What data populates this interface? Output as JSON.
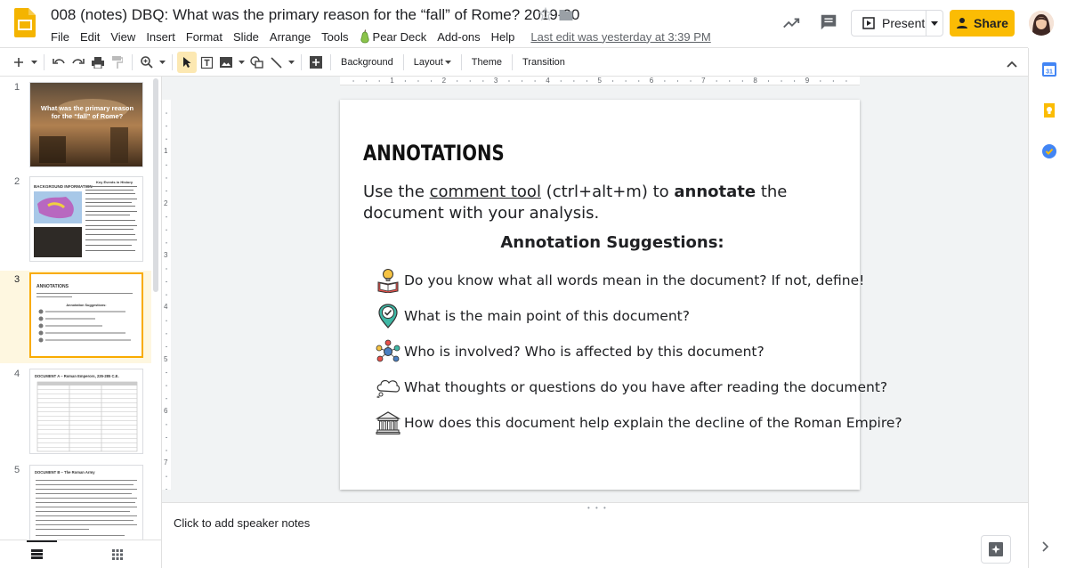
{
  "header": {
    "doc_title": "008 (notes) DBQ: What was the primary reason for the “fall” of Rome? 2019-20",
    "menu": [
      "File",
      "Edit",
      "View",
      "Insert",
      "Format",
      "Slide",
      "Arrange",
      "Tools"
    ],
    "peardeck_label": "Pear Deck",
    "menu_after": [
      "Add-ons",
      "Help"
    ],
    "last_edit": "Last edit was yesterday at 3:39 PM",
    "present_label": "Present",
    "share_label": "Share"
  },
  "toolbar": {
    "background_label": "Background",
    "layout_label": "Layout",
    "theme_label": "Theme",
    "transition_label": "Transition"
  },
  "ruler": {
    "h_marks": [
      "1",
      "2",
      "3",
      "4",
      "5",
      "6",
      "7",
      "8",
      "9"
    ],
    "v_marks": [
      "1",
      "2",
      "3",
      "4",
      "5",
      "6",
      "7"
    ]
  },
  "filmstrip": {
    "slides": [
      {
        "num": "1",
        "title": "What was the primary reason for the “fall” of Rome?"
      },
      {
        "num": "2",
        "title": "BACKGROUND INFORMATION",
        "sub": "Key Events in History"
      },
      {
        "num": "3",
        "title": "ANNOTATIONS",
        "sub": "Annotation Suggestions:"
      },
      {
        "num": "4",
        "title": "DOCUMENT A – Roman Emperors, 235-285 C.E."
      },
      {
        "num": "5",
        "title": "DOCUMENT B – The Roman Army"
      }
    ]
  },
  "slide": {
    "heading": "ANNOTATIONS",
    "intro_1": "Use the ",
    "intro_link": "comment tool",
    "intro_2": " (ctrl+alt+m) to ",
    "intro_bold": "annotate",
    "intro_3": " the document with your analysis.",
    "sugg_title": "Annotation Suggestions:",
    "suggestions": [
      {
        "icon": "book-lightbulb-icon",
        "text": "Do you know what all words mean in the document? If not, define!"
      },
      {
        "icon": "location-check-icon",
        "text": "What is the main point of this document?"
      },
      {
        "icon": "people-network-icon",
        "text": "Who is involved? Who is affected by this document?"
      },
      {
        "icon": "thought-cloud-icon",
        "text": "What thoughts or questions do you have after reading the document?"
      },
      {
        "icon": "greek-temple-icon",
        "text": "How does this document help explain the decline of the Roman Empire?"
      }
    ]
  },
  "notes": {
    "placeholder": "Click to add speaker notes"
  },
  "colors": {
    "accent_yellow": "#fbbc04",
    "selected_border": "#f9ab00",
    "canvas_bg": "#f1f3f4"
  }
}
